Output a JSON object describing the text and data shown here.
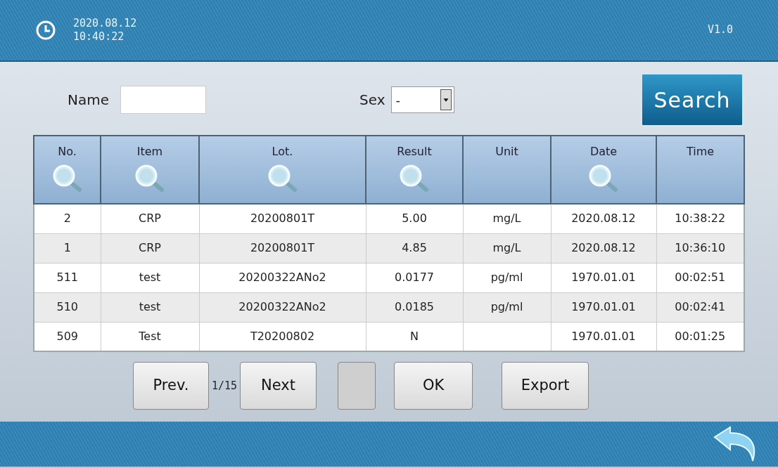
{
  "header": {
    "date": "2020.08.12",
    "time": "10:40:22",
    "version": "V1.0"
  },
  "filters": {
    "name_label": "Name",
    "sex_label": "Sex",
    "sex_value": "-",
    "search_button": "Search"
  },
  "table": {
    "columns": [
      {
        "label": "No.",
        "searchable": true
      },
      {
        "label": "Item",
        "searchable": true
      },
      {
        "label": "Lot.",
        "searchable": true
      },
      {
        "label": "Result",
        "searchable": true
      },
      {
        "label": "Unit",
        "searchable": false
      },
      {
        "label": "Date",
        "searchable": true
      },
      {
        "label": "Time",
        "searchable": false
      }
    ],
    "rows": [
      [
        "2",
        "CRP",
        "20200801T",
        "5.00",
        "mg/L",
        "2020.08.12",
        "10:38:22"
      ],
      [
        "1",
        "CRP",
        "20200801T",
        "4.85",
        "mg/L",
        "2020.08.12",
        "10:36:10"
      ],
      [
        "511",
        "test",
        "20200322ANo2",
        "0.0177",
        "pg/ml",
        "1970.01.01",
        "00:02:51"
      ],
      [
        "510",
        "test",
        "20200322ANo2",
        "0.0185",
        "pg/ml",
        "1970.01.01",
        "00:02:41"
      ],
      [
        "509",
        "Test",
        "T20200802",
        "N",
        "",
        "1970.01.01",
        "00:01:25"
      ]
    ]
  },
  "pager": {
    "prev": "Prev.",
    "page": "1/15",
    "next": "Next"
  },
  "actions": [
    {
      "kind": "blank"
    },
    {
      "kind": "text",
      "label": "OK"
    },
    {
      "kind": "text",
      "label": "Export"
    }
  ]
}
